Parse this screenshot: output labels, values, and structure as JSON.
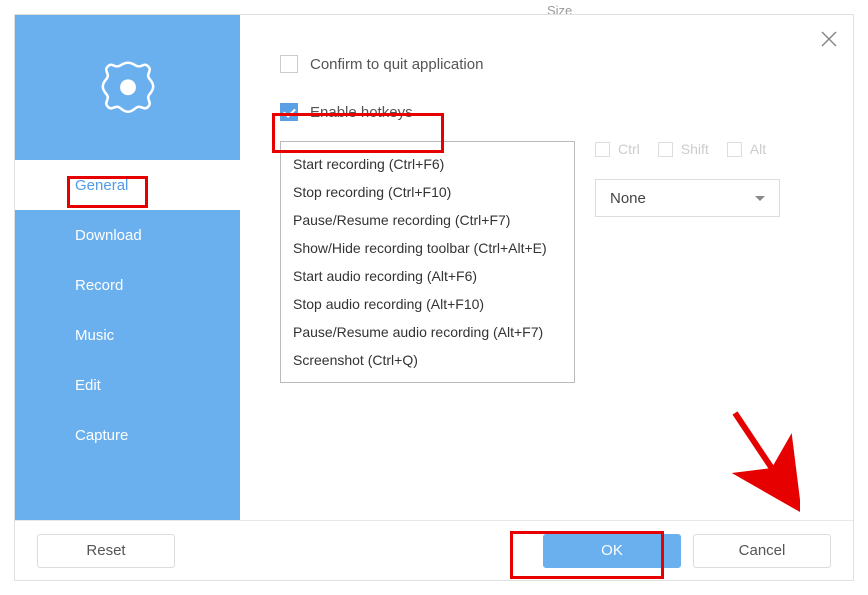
{
  "bgText": "Size",
  "sidebar": {
    "items": [
      {
        "label": "General",
        "active": true
      },
      {
        "label": "Download",
        "active": false
      },
      {
        "label": "Record",
        "active": false
      },
      {
        "label": "Music",
        "active": false
      },
      {
        "label": "Edit",
        "active": false
      },
      {
        "label": "Capture",
        "active": false
      }
    ]
  },
  "checkboxes": {
    "confirmQuit": {
      "label": "Confirm to quit application",
      "checked": false
    },
    "enableHotkeys": {
      "label": "Enable hotkeys",
      "checked": true
    }
  },
  "hotkeys": [
    "Start recording (Ctrl+F6)",
    "Stop recording (Ctrl+F10)",
    "Pause/Resume recording (Ctrl+F7)",
    "Show/Hide recording toolbar (Ctrl+Alt+E)",
    "Start audio recording (Alt+F6)",
    "Stop audio recording (Alt+F10)",
    "Pause/Resume audio recording (Alt+F7)",
    "Screenshot (Ctrl+Q)"
  ],
  "modifiers": {
    "ctrl": "Ctrl",
    "shift": "Shift",
    "alt": "Alt"
  },
  "keySelect": "None",
  "buttons": {
    "reset": "Reset",
    "ok": "OK",
    "cancel": "Cancel"
  }
}
